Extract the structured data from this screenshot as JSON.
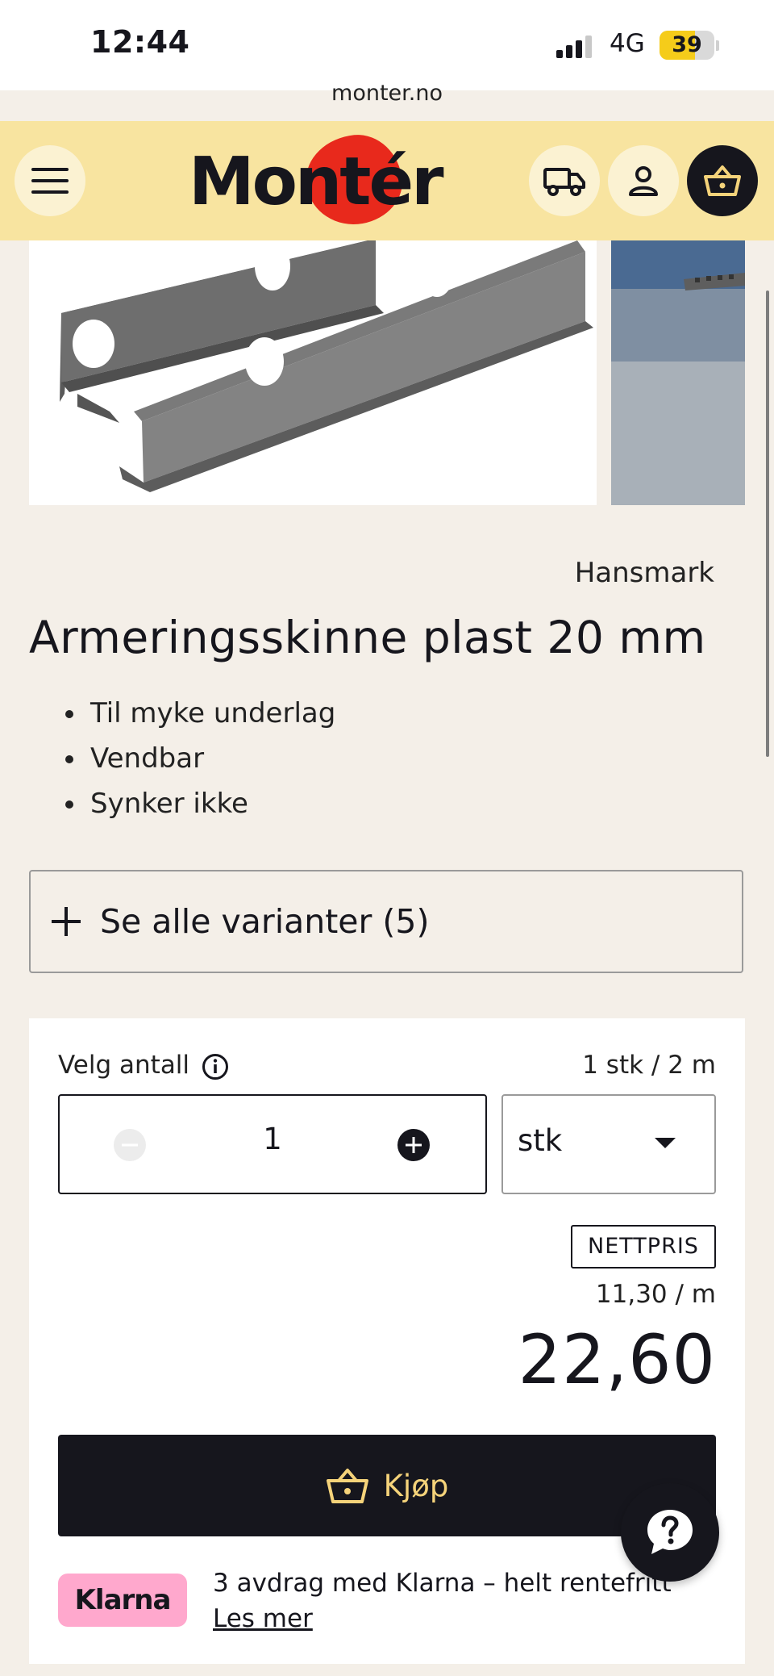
{
  "status_bar": {
    "time": "12:44",
    "network": "4G",
    "battery": "39"
  },
  "browser": {
    "url": "monter.no"
  },
  "header": {
    "logo_text": "Montér",
    "menu_icon": "hamburger-icon",
    "delivery_icon": "truck-icon",
    "account_icon": "user-icon",
    "cart_icon": "basket-icon"
  },
  "product": {
    "brand": "Hansmark",
    "title": "Armeringsskinne plast 20 mm",
    "features": [
      "Til myke underlag",
      "Vendbar",
      "Synker ikke"
    ],
    "variants_label": "Se alle varianter (5)"
  },
  "purchase": {
    "quantity_label": "Velg antall",
    "unit_info": "1 stk / 2 m",
    "quantity": "1",
    "unit": "stk",
    "price_tag": "NETTPRIS",
    "unit_price": "11,30 / m",
    "price": "22,60",
    "buy_label": "Kjøp"
  },
  "klarna": {
    "badge": "Klarna",
    "text": "3 avdrag med Klarna – helt rentefritt",
    "link": "Les mer"
  },
  "colors": {
    "header_bg": "#f8e4a0",
    "page_bg": "#f4efe8",
    "dark": "#16161d",
    "accent_gold": "#f5d37a",
    "logo_red": "#e8291c",
    "klarna_pink": "#ffa8cd"
  }
}
